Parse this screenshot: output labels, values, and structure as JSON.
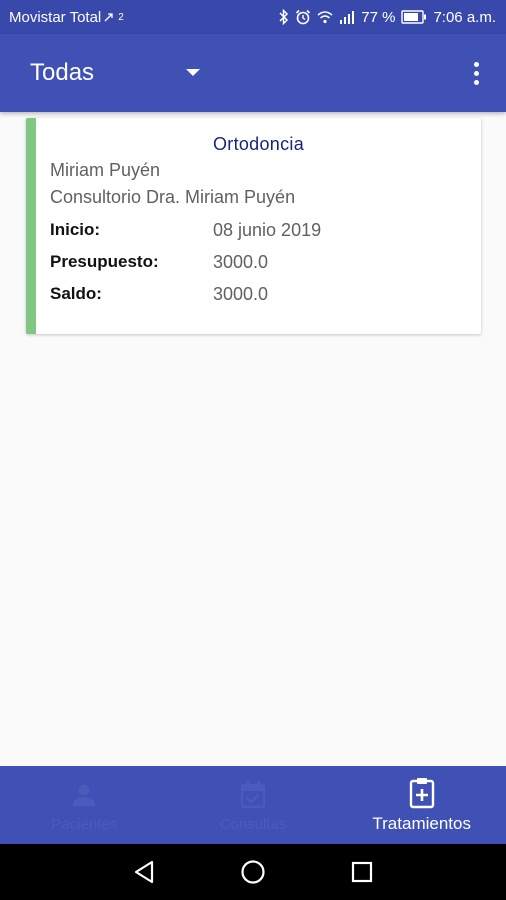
{
  "status_bar": {
    "carrier": "Movistar Total",
    "carrier_sup": "2",
    "battery": "77 %",
    "time": "7:06 a.m."
  },
  "app_bar": {
    "filter_label": "Todas",
    "color": "#3f51b5"
  },
  "treatments": [
    {
      "title": "Ortodoncia",
      "patient": "Miriam Puyén",
      "clinic": "Consultorio Dra. Miriam Puyén",
      "start_label": "Inicio:",
      "start_value": "08 junio 2019",
      "budget_label": "Presupuesto:",
      "budget_value": "3000.0",
      "balance_label": "Saldo:",
      "balance_value": "3000.0",
      "accent": "#81c784"
    }
  ],
  "bottom_nav": {
    "items": [
      {
        "label": "Pacientes",
        "icon": "person-icon",
        "active": false
      },
      {
        "label": "Consultas",
        "icon": "calendar-icon",
        "active": false
      },
      {
        "label": "Tratamientos",
        "icon": "clipboard-plus-icon",
        "active": true
      }
    ]
  },
  "system_nav": {
    "buttons": [
      "back-icon",
      "home-icon",
      "recents-icon"
    ]
  }
}
